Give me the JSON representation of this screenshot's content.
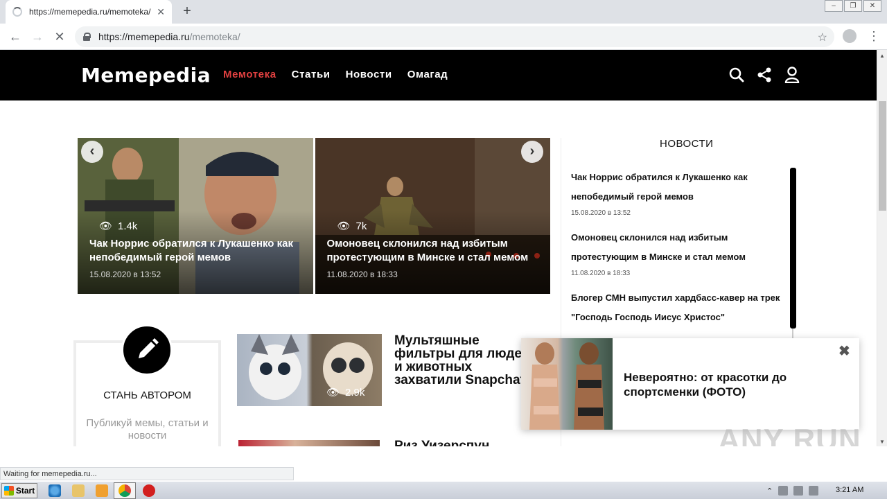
{
  "browser": {
    "tab_title": "https://memepedia.ru/memoteka/",
    "tab_close": "✕",
    "new_tab": "+",
    "url_host": "https://memepedia.ru",
    "url_path": "/memoteka/",
    "status_text": "Waiting for memepedia.ru..."
  },
  "site": {
    "logo": "Memepedia",
    "nav": [
      "Мемотека",
      "Статьи",
      "Новости",
      "Омагад"
    ],
    "accent_color": "#e04040"
  },
  "slider": {
    "slides": [
      {
        "views": "1.4k",
        "title": "Чак Норрис обратился к Лукашенко как непобедимый герой мемов",
        "date": "15.08.2020 в 13:52"
      },
      {
        "views": "7k",
        "title": "Омоновец склонился над избитым протестующим в Минске и стал мемом",
        "date": "11.08.2020 в 18:33"
      }
    ]
  },
  "author": {
    "title": "СТАНЬ АВТОРОМ",
    "text": "Публикуй мемы, статьи и новости"
  },
  "articles": [
    {
      "views": "2.9k",
      "title": "Мультяшные фильтры для людей и животных захватили Snapchat"
    },
    {
      "title": "Риз Уизерспун"
    }
  ],
  "news": {
    "heading": "НОВОСТИ",
    "items": [
      {
        "title": "Чак Норрис обратился к Лукашенко как непобедимый герой мемов",
        "date": "15.08.2020 в 13:52"
      },
      {
        "title": "Омоновец склонился над избитым протестующим в Минске и стал мемом",
        "date": "11.08.2020 в 18:33"
      },
      {
        "title": "Блогер СМН выпустил хардбасс-кавер на трек \"Господь Господь Иисус Христос\"",
        "date": ""
      }
    ]
  },
  "popup": {
    "title": "Невероятно: от красотки до спортсменки (ФОТО)",
    "close": "✖"
  },
  "watermark": "ANY RUN",
  "taskbar": {
    "start": "Start",
    "clock": "3:21 AM"
  }
}
